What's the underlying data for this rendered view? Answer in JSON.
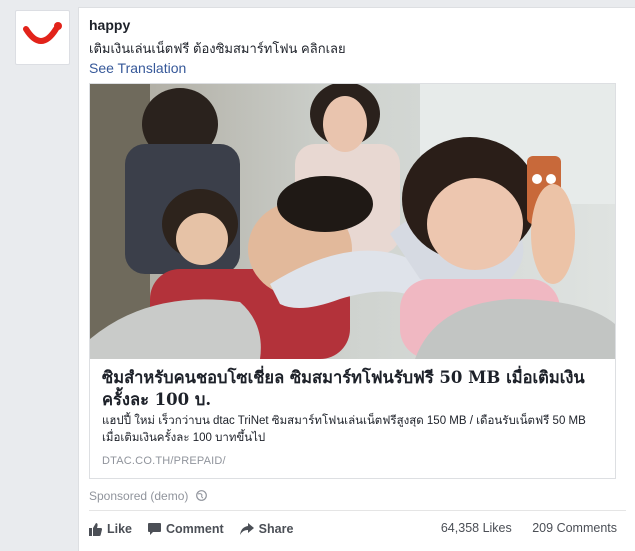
{
  "post": {
    "page_name": "happy",
    "text": "เติมเงินเล่นเน็ตฟรี ต้องซิมสมาร์ทโฟน คลิกเลย",
    "see_translation": "See Translation"
  },
  "link_preview": {
    "headline": "ซิมสำหรับคนชอบโซเชี่ยล ซิมสมาร์ทโฟนรับฟรี 50 MB เมื่อเติมเงินครั้งละ 100 บ.",
    "description": "แฮปปี้ ใหม่ เร็วกว่าบน dtac TriNet ซิมสมาร์ทโฟนเล่นเน็ตฟรีสูงสุด 150 MB / เดือนรับเน็ตฟรี 50 MB เมื่อเติมเงินครั้งละ 100 บาทขึ้นไป",
    "domain": "DTAC.CO.TH/PREPAID/"
  },
  "sponsored": "Sponsored (demo)",
  "actions": {
    "like": "Like",
    "comment": "Comment",
    "share": "Share"
  },
  "stats": {
    "likes": "64,358 Likes",
    "comments": "209 Comments"
  },
  "colors": {
    "link_blue": "#365899",
    "brand_red": "#e2231a",
    "text_dark": "#1d2129",
    "text_gray": "#90949c"
  },
  "icons": [
    "happy-logo-icon",
    "globe-icon",
    "like-icon",
    "comment-icon",
    "share-icon"
  ]
}
